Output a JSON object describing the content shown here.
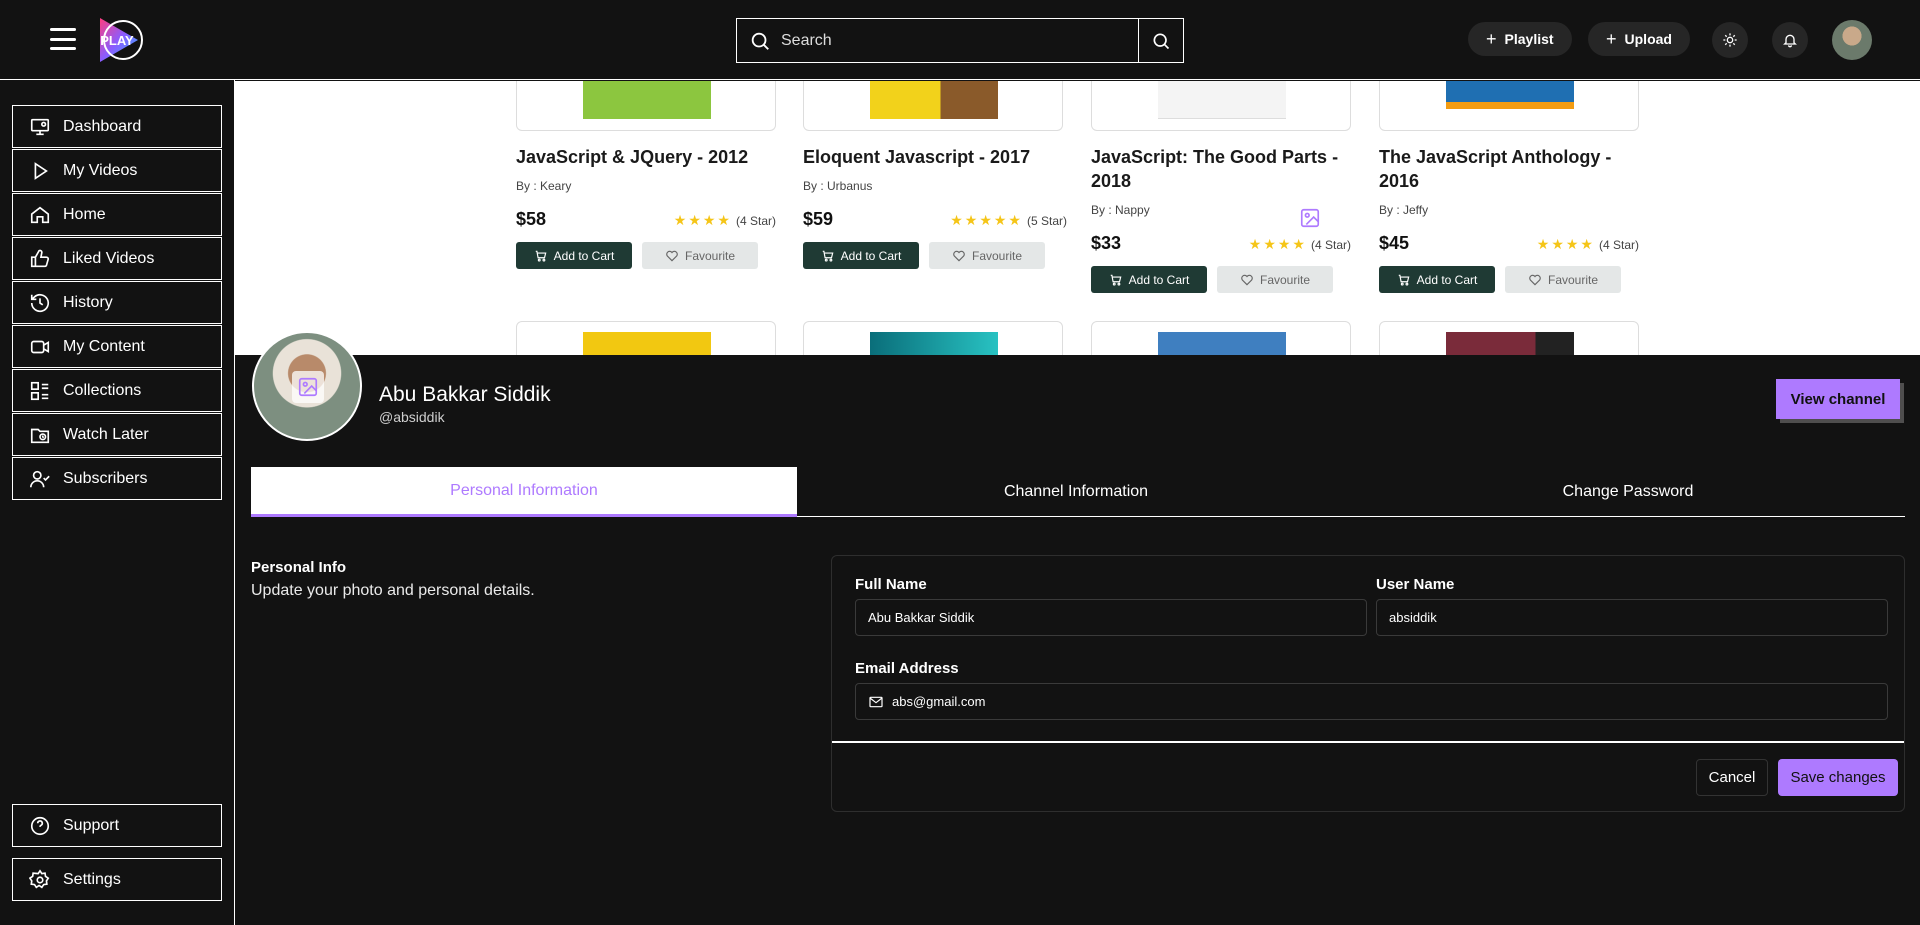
{
  "header": {
    "logo_text": "PLAY",
    "search_placeholder": "Search",
    "playlist_label": "Playlist",
    "upload_label": "Upload"
  },
  "sidebar": {
    "items": [
      {
        "label": "Dashboard",
        "icon": "dashboard-icon"
      },
      {
        "label": "My Videos",
        "icon": "play-icon"
      },
      {
        "label": "Home",
        "icon": "home-icon"
      },
      {
        "label": "Liked Videos",
        "icon": "thumbs-up-icon"
      },
      {
        "label": "History",
        "icon": "history-icon"
      },
      {
        "label": "My Content",
        "icon": "video-camera-icon"
      },
      {
        "label": "Collections",
        "icon": "collections-icon"
      },
      {
        "label": "Watch Later",
        "icon": "clock-folder-icon"
      },
      {
        "label": "Subscribers",
        "icon": "user-check-icon"
      }
    ],
    "bottom": [
      {
        "label": "Support",
        "icon": "help-circle-icon"
      },
      {
        "label": "Settings",
        "icon": "gear-icon"
      }
    ]
  },
  "books": [
    {
      "title": "JavaScript & JQuery - 2012",
      "author": "By : Keary",
      "price": "$58",
      "rating": "(4 Star)",
      "stars": 4,
      "cover_color": "#8cc63f"
    },
    {
      "title": "Eloquent Javascript - 2017",
      "author": "By : Urbanus",
      "price": "$59",
      "rating": "(5 Star)",
      "stars": 5,
      "cover_color": "#f2d21b"
    },
    {
      "title": "JavaScript: The Good Parts - 2018",
      "author": "By : Nappy",
      "price": "$33",
      "rating": "(4 Star)",
      "stars": 4,
      "cover_color": "#f4f4f4"
    },
    {
      "title": "The JavaScript Anthology - 2016",
      "author": "By : Jeffy",
      "price": "$45",
      "rating": "(4 Star)",
      "stars": 4,
      "cover_color": "#1f6fb2"
    }
  ],
  "book_buttons": {
    "cart": "Add to Cart",
    "favourite": "Favourite"
  },
  "profile": {
    "name": "Abu Bakkar Siddik",
    "handle": "@absiddik",
    "view_channel_label": "View channel"
  },
  "tabs": [
    {
      "label": "Personal Information",
      "active": true
    },
    {
      "label": "Channel Information",
      "active": false
    },
    {
      "label": "Change Password",
      "active": false
    }
  ],
  "personal_info": {
    "title": "Personal Info",
    "description": "Update your photo and personal details."
  },
  "form": {
    "full_name_label": "Full Name",
    "full_name_value": "Abu Bakkar Siddik",
    "user_name_label": "User Name",
    "user_name_value": "absiddik",
    "email_label": "Email Address",
    "email_value": "abs@gmail.com",
    "cancel_label": "Cancel",
    "save_label": "Save changes"
  },
  "colors": {
    "accent": "#ae7aff",
    "cart_button": "#1f3a34",
    "star": "#f5c518"
  }
}
